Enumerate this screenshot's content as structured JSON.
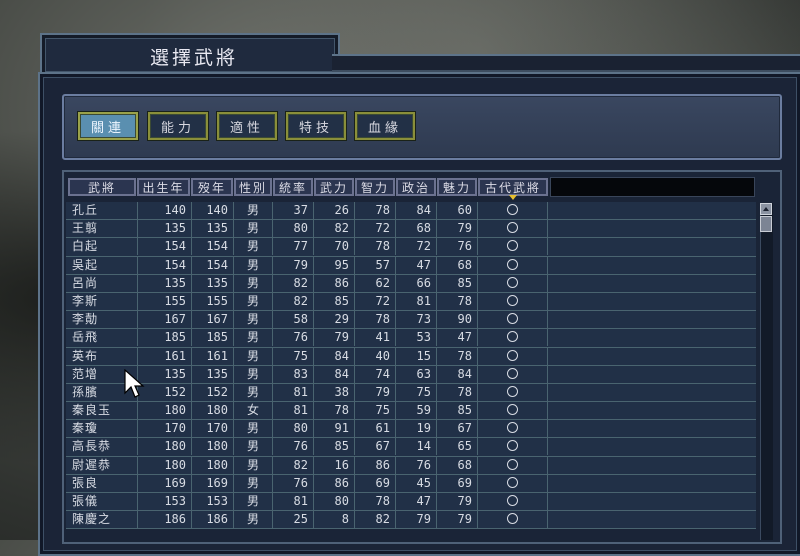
{
  "window": {
    "title": "選擇武將"
  },
  "tabs": [
    {
      "label": "關連",
      "active": true
    },
    {
      "label": "能力",
      "active": false
    },
    {
      "label": "適性",
      "active": false
    },
    {
      "label": "特技",
      "active": false
    },
    {
      "label": "血緣",
      "active": false
    }
  ],
  "table": {
    "headers": [
      "武將",
      "出生年",
      "歿年",
      "性別",
      "統率",
      "武力",
      "智力",
      "政治",
      "魅力",
      "古代武將"
    ],
    "rows": [
      [
        "孔丘",
        "140",
        "140",
        "男",
        "37",
        "26",
        "78",
        "84",
        "60"
      ],
      [
        "王翦",
        "135",
        "135",
        "男",
        "80",
        "82",
        "72",
        "68",
        "79"
      ],
      [
        "白起",
        "154",
        "154",
        "男",
        "77",
        "70",
        "78",
        "72",
        "76"
      ],
      [
        "吳起",
        "154",
        "154",
        "男",
        "79",
        "95",
        "57",
        "47",
        "68"
      ],
      [
        "呂尚",
        "135",
        "135",
        "男",
        "82",
        "86",
        "62",
        "66",
        "85"
      ],
      [
        "李斯",
        "155",
        "155",
        "男",
        "82",
        "85",
        "72",
        "81",
        "78"
      ],
      [
        "李勣",
        "167",
        "167",
        "男",
        "58",
        "29",
        "78",
        "73",
        "90"
      ],
      [
        "岳飛",
        "185",
        "185",
        "男",
        "76",
        "79",
        "41",
        "53",
        "47"
      ],
      [
        "英布",
        "161",
        "161",
        "男",
        "75",
        "84",
        "40",
        "15",
        "78"
      ],
      [
        "范增",
        "135",
        "135",
        "男",
        "83",
        "84",
        "74",
        "63",
        "84"
      ],
      [
        "孫臏",
        "152",
        "152",
        "男",
        "81",
        "38",
        "79",
        "75",
        "78"
      ],
      [
        "秦良玉",
        "180",
        "180",
        "女",
        "81",
        "78",
        "75",
        "59",
        "85"
      ],
      [
        "秦瓊",
        "170",
        "170",
        "男",
        "80",
        "91",
        "61",
        "19",
        "67"
      ],
      [
        "高長恭",
        "180",
        "180",
        "男",
        "76",
        "85",
        "67",
        "14",
        "65"
      ],
      [
        "尉遲恭",
        "180",
        "180",
        "男",
        "82",
        "16",
        "86",
        "76",
        "68"
      ],
      [
        "張良",
        "169",
        "169",
        "男",
        "76",
        "86",
        "69",
        "45",
        "69"
      ],
      [
        "張儀",
        "153",
        "153",
        "男",
        "81",
        "80",
        "78",
        "47",
        "79"
      ],
      [
        "陳慶之",
        "186",
        "186",
        "男",
        "25",
        "8",
        "82",
        "79",
        "79"
      ]
    ]
  }
}
